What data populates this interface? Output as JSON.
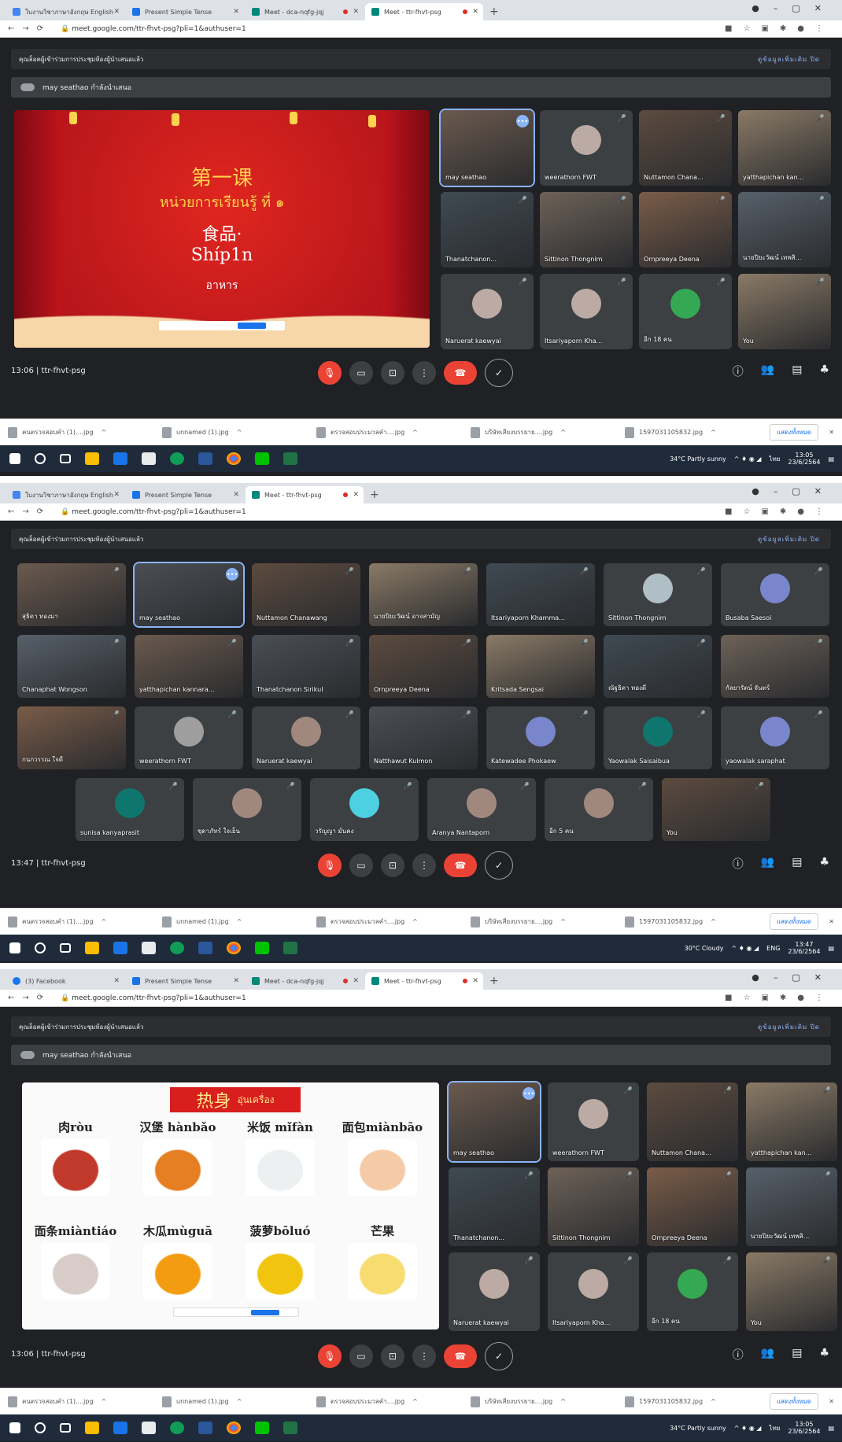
{
  "browser": {
    "tabs_1": [
      "ใบงานวิชาภาษาอังกฤษ English",
      "Present Simple Tense",
      "Meet - dca-nqfg-jqj",
      "Meet - ttr-fhvt-psg"
    ],
    "tabs_3": [
      "(3) Facebook",
      "Present Simple Tense",
      "Meet - dca-nqfg-jqj",
      "Meet - ttr-fhvt-psg"
    ],
    "url": "meet.google.com/ttr-fhvt-psg?pli=1&authuser=1"
  },
  "meet": {
    "banner_text": "คุณล็อคผู้เข้าร่วมการประชุมห้องผู้นำเสนอแล้ว",
    "banner_links": "ดูข้อมูลเพิ่มเติม    ปิด",
    "presenting": "may seathao กำลังนำเสนอ",
    "info_1": "13:06  |  ttr-fhvt-psg",
    "info_2": "13:47  |  ttr-fhvt-psg",
    "info_3": "13:06  |  ttr-fhvt-psg"
  },
  "slide1": {
    "title": "第一课",
    "unit": "หน่วยการเรียนรู้ ที่ ๑",
    "topic": "食品·",
    "pinyin": "Shíp1n",
    "thai": "อาหาร"
  },
  "slide3": {
    "header_cn": "热身",
    "header_th": "อุ่นเครื่อง",
    "foods": [
      "肉ròu",
      "汉堡 hànbǎo",
      "米饭 mǐfàn",
      "面包miànbāo",
      "面条miàntiáo",
      "木瓜mùguā",
      "菠萝bōluó",
      "芒果"
    ]
  },
  "participants_small": [
    "may seathao",
    "weerathorn FWT",
    "Nuttamon Chana...",
    "yatthapichan kan...",
    "Thanatchanon...",
    "Sittinon Thongnim",
    "Ornpreeya Deena",
    "นายปิยะวัฒน์ เทพสิ...",
    "Naruerat kaewyai",
    "Itsariyaporn Kha...",
    "อีก 18 คน",
    "You"
  ],
  "participants_grid": [
    "สุธิดา ทองมา",
    "may seathao",
    "Nuttamon Chanawang",
    "นายปิยะวัฒน์ อาจสามัญ",
    "Itsariyaporn Khamma...",
    "Sittinon Thongnim",
    "Busaba Saesoi",
    "Chanaphat Wongson",
    "yatthapichan kannara...",
    "Thanatchanon Sirikul",
    "Ornpreeya Deena",
    "Kritsada Sengsai",
    "ณัฐธิดา ทองดี",
    "กัลยารัตน์ จันทร์",
    "กนกวรรณ ใจดี",
    "weerathorn FWT",
    "Naruerat kaewyai",
    "Natthawut Kulmon",
    "Katewadee Phokaew",
    "Yaowalak Saisaibua",
    "yaowalak saraphat",
    "sunisa kanyaprasit",
    "ชุดาภัทร์ ใจเย็น",
    "วรัญญา มั่นคง",
    "Aranya Nantaporn",
    "อีก 5 คน",
    "You"
  ],
  "downloads": [
    "คนตรวจสอบคำ (1)....jpg",
    "unnamed (1).jpg",
    "ตรวจสอบประมวลคำ....jpg",
    "บริษัทเสียงบรรยาย....jpg",
    "1597031105832.jpg"
  ],
  "show_all": "แสดงทั้งหมด",
  "taskbar": {
    "weather_1": "34°C Partly sunny",
    "weather_2": "30°C Cloudy",
    "time_1": "13:05",
    "time_2": "13:47",
    "date": "23/6/2564",
    "lang_1": "ไทย",
    "lang_2": "ENG"
  },
  "colors": {
    "meet_bg": "#202124",
    "tile_bg": "#3c4043",
    "end_call": "#ea4335",
    "slide_red": "#c8102e",
    "accent": "#8ab4f8"
  }
}
